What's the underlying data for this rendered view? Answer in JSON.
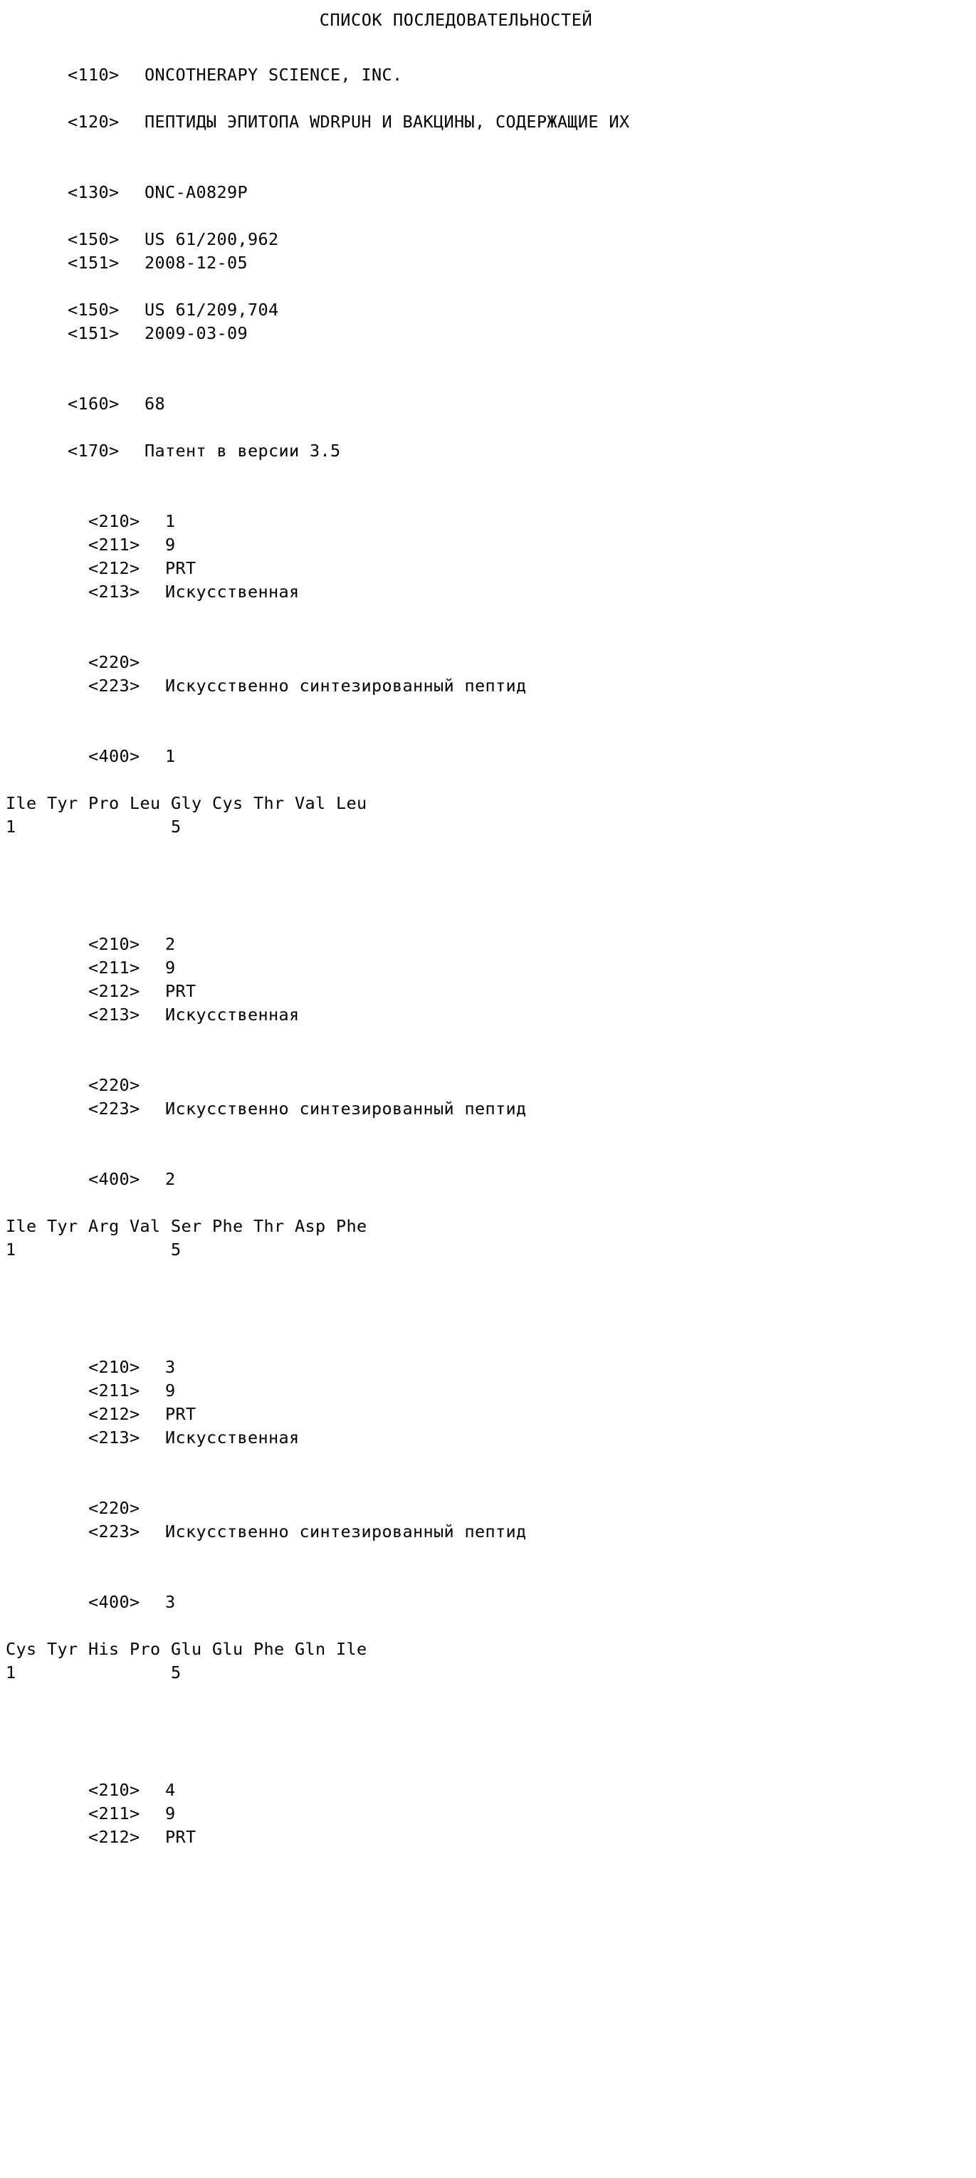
{
  "document": {
    "title": "СПИСОК ПОСЛЕДОВАТЕЛЬНОСТЕЙ",
    "language": "ru",
    "type": "patent-sequence-listing"
  },
  "header_fields": [
    {
      "tag": "<110>",
      "value": "ONCOTHERAPY SCIENCE, INC."
    },
    {
      "tag": "<120>",
      "value": "ПЕПТИДЫ ЭПИТОПА WDRPUH И ВАКЦИНЫ, СОДЕРЖАЩИЕ ИХ"
    },
    {
      "tag": "<130>",
      "value": "ONC-A0829P"
    },
    {
      "tag": "<150>",
      "value": "US 61/200,962"
    },
    {
      "tag": "<151>",
      "value": "2008-12-05"
    },
    {
      "tag": "<150>",
      "value": "US 61/209,704"
    },
    {
      "tag": "<151>",
      "value": "2009-03-09"
    },
    {
      "tag": "<160>",
      "value": "68"
    },
    {
      "tag": "<170>",
      "value": "Патент в версии 3.5"
    }
  ],
  "sequences": [
    {
      "id_tag": "<210>",
      "id_value": "1",
      "length_tag": "<211>",
      "length_value": "9",
      "type_tag": "<212>",
      "type_value": "PRT",
      "organism_tag": "<213>",
      "organism_value": "Искусственная",
      "feature_tag": "<220>",
      "feature_value": "",
      "other_tag": "<223>",
      "other_value": "Искусственно синтезированный пептид",
      "seq_tag": "<400>",
      "seq_value": "1",
      "residues": "Ile Tyr Pro Leu Gly Cys Thr Val Leu",
      "position_ruler": "1               5"
    },
    {
      "id_tag": "<210>",
      "id_value": "2",
      "length_tag": "<211>",
      "length_value": "9",
      "type_tag": "<212>",
      "type_value": "PRT",
      "organism_tag": "<213>",
      "organism_value": "Искусственная",
      "feature_tag": "<220>",
      "feature_value": "",
      "other_tag": "<223>",
      "other_value": "Искусственно синтезированный пептид",
      "seq_tag": "<400>",
      "seq_value": "2",
      "residues": "Ile Tyr Arg Val Ser Phe Thr Asp Phe",
      "position_ruler": "1               5"
    },
    {
      "id_tag": "<210>",
      "id_value": "3",
      "length_tag": "<211>",
      "length_value": "9",
      "type_tag": "<212>",
      "type_value": "PRT",
      "organism_tag": "<213>",
      "organism_value": "Искусственная",
      "feature_tag": "<220>",
      "feature_value": "",
      "other_tag": "<223>",
      "other_value": "Искусственно синтезированный пептид",
      "seq_tag": "<400>",
      "seq_value": "3",
      "residues": "Cys Tyr His Pro Glu Glu Phe Gln Ile",
      "position_ruler": "1               5"
    }
  ],
  "trailing_sequence": {
    "id_tag": "<210>",
    "id_value": "4",
    "length_tag": "<211>",
    "length_value": "9",
    "type_tag": "<212>",
    "type_value": "PRT"
  }
}
